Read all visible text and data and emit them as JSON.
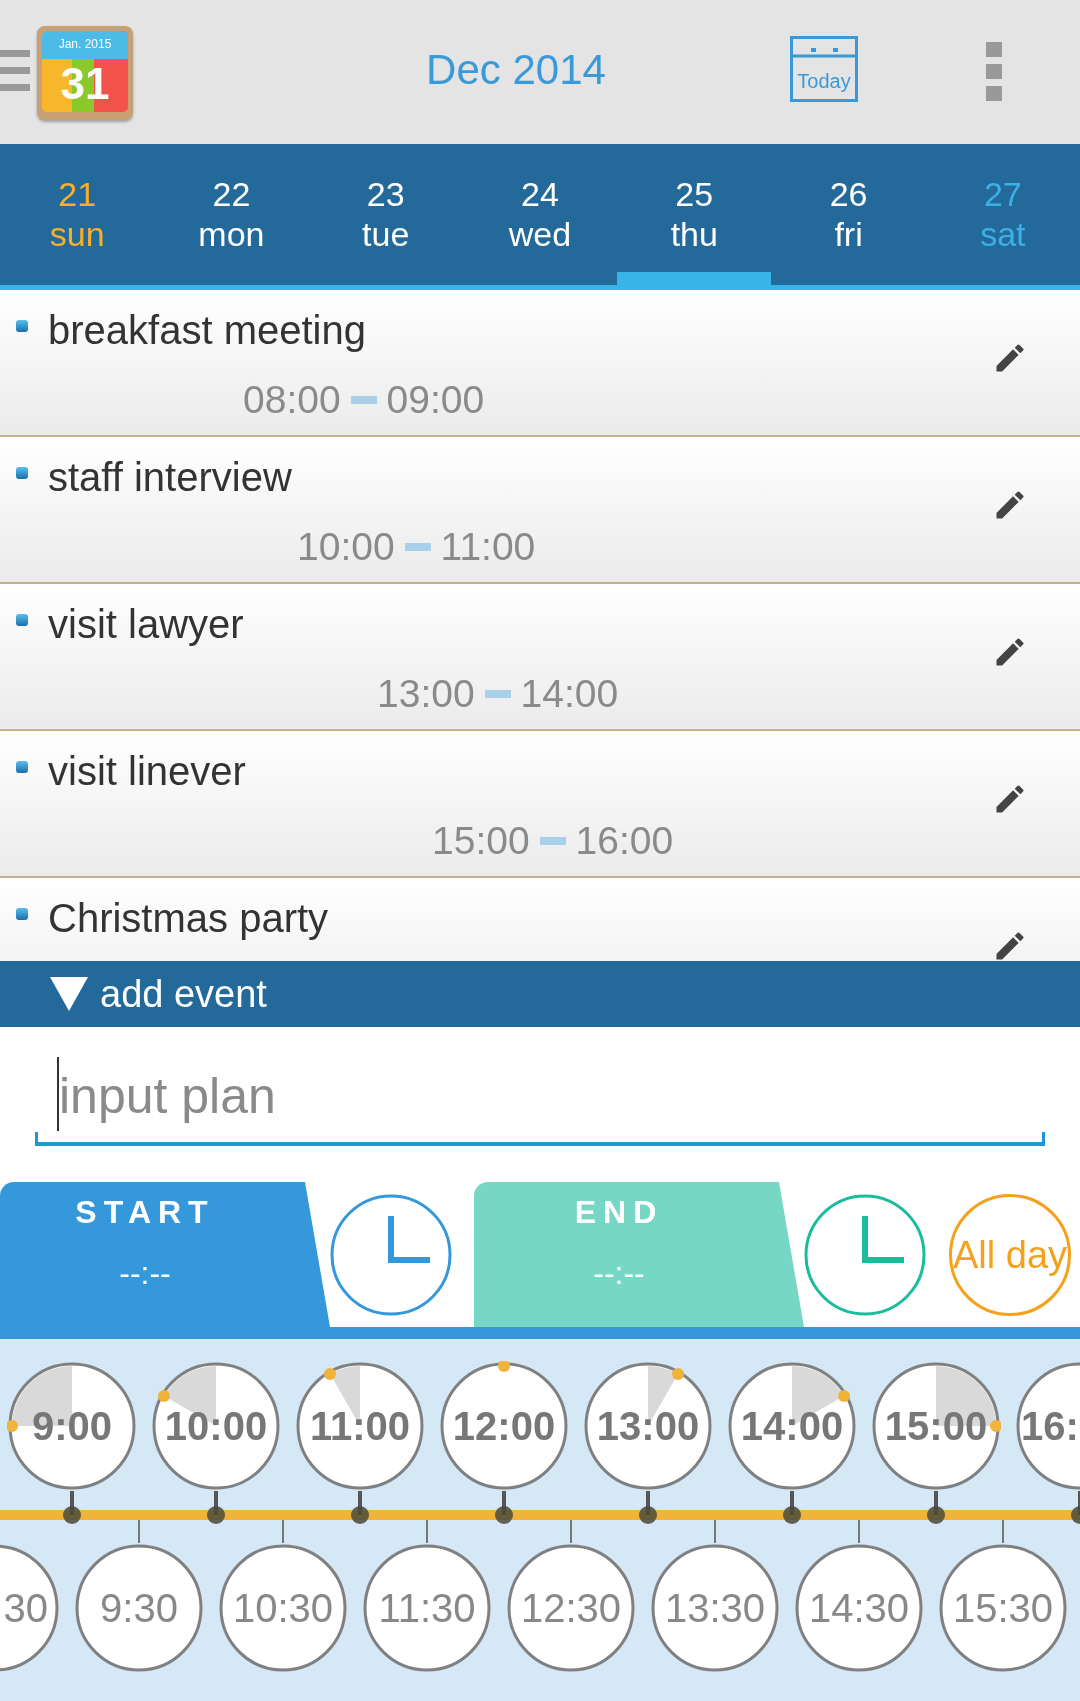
{
  "header": {
    "logo": {
      "month": "Jan. 2015",
      "day": "31"
    },
    "title": "Dec 2014",
    "today_button": "Today"
  },
  "days": [
    {
      "number": "21",
      "name": "sun",
      "color": "#f6b02a",
      "selected": false
    },
    {
      "number": "22",
      "name": "mon",
      "color": "#ffffff",
      "selected": false
    },
    {
      "number": "23",
      "name": "tue",
      "color": "#ffffff",
      "selected": false
    },
    {
      "number": "24",
      "name": "wed",
      "color": "#ffffff",
      "selected": false
    },
    {
      "number": "25",
      "name": "thu",
      "color": "#ffffff",
      "selected": true
    },
    {
      "number": "26",
      "name": "fri",
      "color": "#ffffff",
      "selected": false
    },
    {
      "number": "27",
      "name": "sat",
      "color": "#3bb0e6",
      "selected": false
    }
  ],
  "events": [
    {
      "title": "breakfast meeting",
      "start": "08:00",
      "end": "09:00"
    },
    {
      "title": "staff interview",
      "start": "10:00",
      "end": "11:00"
    },
    {
      "title": "visit lawyer",
      "start": "13:00",
      "end": "14:00"
    },
    {
      "title": "visit linever",
      "start": "15:00",
      "end": "16:00"
    },
    {
      "title": "Christmas party"
    }
  ],
  "add_event": {
    "label": "add event",
    "input": {
      "placeholder": "input plan"
    }
  },
  "start_tab": {
    "label": "START",
    "value": "--:--"
  },
  "end_tab": {
    "label": "END",
    "value": "--:--"
  },
  "all_day_button": "All day",
  "hour_slots": [
    {
      "label": "9:00"
    },
    {
      "label": "10:00"
    },
    {
      "label": "11:00"
    },
    {
      "label": "12:00"
    },
    {
      "label": "13:00"
    },
    {
      "label": "14:00"
    },
    {
      "label": "15:00"
    },
    {
      "label": "16:"
    }
  ],
  "half_slots": [
    "30",
    "9:30",
    "10:30",
    "11:30",
    "12:30",
    "13:30",
    "14:30",
    "15:30"
  ]
}
